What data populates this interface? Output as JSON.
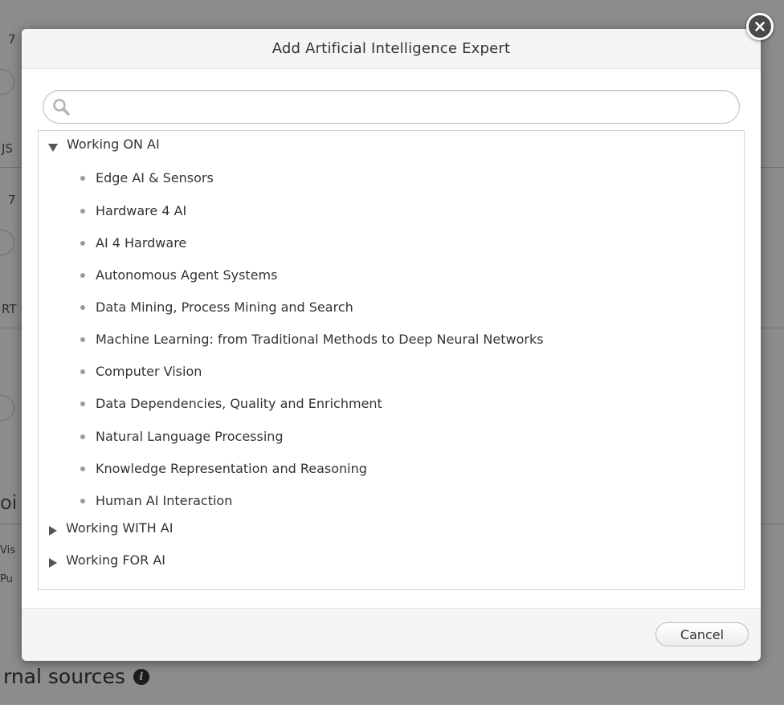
{
  "background": {
    "fragments": [
      "7",
      "JS",
      "7",
      "RT",
      "oi",
      "Vis",
      "Pu"
    ],
    "section_heading": "rnal sources"
  },
  "dialog": {
    "title": "Add Artificial Intelligence Expert",
    "search": {
      "placeholder": "",
      "value": ""
    },
    "tree": {
      "groups": [
        {
          "label": "Working ON AI",
          "expanded": true,
          "items": [
            {
              "label": "Edge AI & Sensors"
            },
            {
              "label": "Hardware 4 AI"
            },
            {
              "label": "AI 4 Hardware"
            },
            {
              "label": "Autonomous Agent Systems"
            },
            {
              "label": "Data Mining, Process Mining and Search"
            },
            {
              "label": "Machine Learning: from Traditional Methods to Deep Neural Networks"
            },
            {
              "label": "Computer Vision"
            },
            {
              "label": "Data Dependencies, Quality and Enrichment"
            },
            {
              "label": "Natural Language Processing"
            },
            {
              "label": "Knowledge Representation and Reasoning"
            },
            {
              "label": "Human AI Interaction"
            }
          ]
        },
        {
          "label": "Working WITH AI",
          "expanded": false
        },
        {
          "label": "Working FOR AI",
          "expanded": false
        }
      ]
    },
    "footer": {
      "cancel_label": "Cancel"
    }
  },
  "icons": {
    "close": "close-icon",
    "search": "search-icon",
    "info": "info-icon",
    "expanded": "triangle-down-icon",
    "collapsed": "triangle-right-icon",
    "bullet": "bullet-icon"
  },
  "colors": {
    "overlay": "#737373",
    "dialog_header_bg": "#f5f5f5",
    "text": "#333333",
    "bullet": "#9b9b9b"
  }
}
